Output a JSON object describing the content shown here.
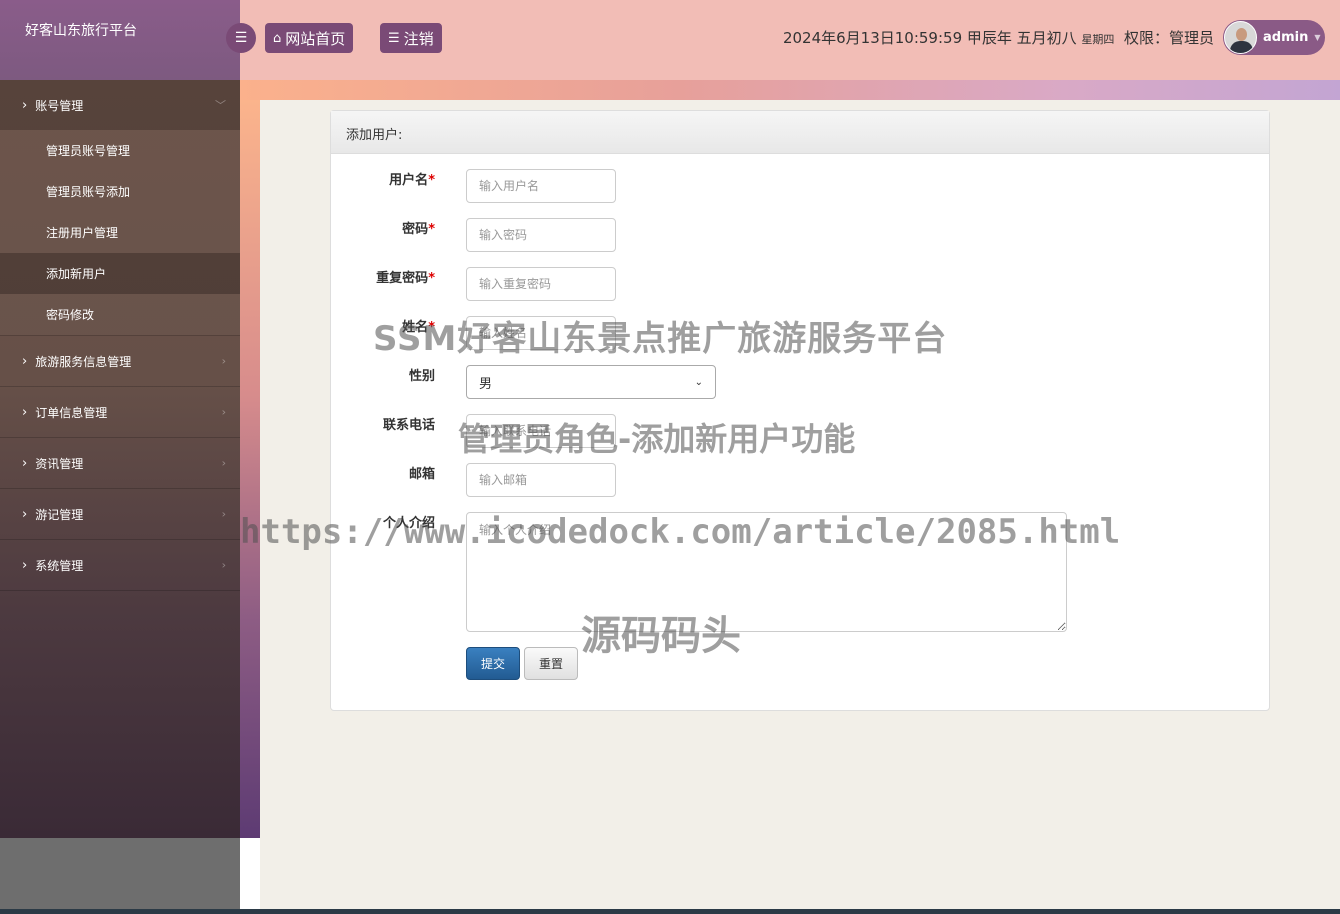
{
  "app": {
    "brand": "好客山东旅行平台"
  },
  "header": {
    "toggle_icon": "☰",
    "home_label": "网站首页",
    "logout_label": "注销",
    "datetime": "2024年6月13日10:59:59 甲辰年 五月初八",
    "weekday": "星期四",
    "role": "权限：管理员",
    "username": "admin"
  },
  "sidebar": {
    "groups": [
      {
        "label": "账号管理",
        "expanded": true,
        "items": [
          "管理员账号管理",
          "管理员账号添加",
          "注册用户管理",
          "添加新用户",
          "密码修改"
        ]
      },
      {
        "label": "旅游服务信息管理"
      },
      {
        "label": "订单信息管理"
      },
      {
        "label": "资讯管理"
      },
      {
        "label": "游记管理"
      },
      {
        "label": "系统管理"
      }
    ]
  },
  "form": {
    "panel_title": "添加用户:",
    "fields": {
      "username": {
        "label": "用户名",
        "required": "*",
        "placeholder": "输入用户名"
      },
      "password": {
        "label": "密码",
        "required": "*",
        "placeholder": "输入密码"
      },
      "repassword": {
        "label": "重复密码",
        "required": "*",
        "placeholder": "输入重复密码"
      },
      "name": {
        "label": "姓名",
        "required": "*",
        "placeholder": "输入姓名"
      },
      "gender": {
        "label": "性别",
        "value": "男"
      },
      "phone": {
        "label": "联系电话",
        "placeholder": "输入联系电话"
      },
      "email": {
        "label": "邮箱",
        "placeholder": "输入邮箱"
      },
      "intro": {
        "label": "个人介绍",
        "placeholder": "输入个人介绍"
      }
    },
    "submit_label": "提交",
    "reset_label": "重置"
  },
  "watermarks": {
    "line1": "SSM好客山东景点推广旅游服务平台",
    "line2": "管理员角色-添加新用户功能",
    "line3": "https://www.icodedock.com/article/2085.html",
    "line4": "源码码头"
  }
}
